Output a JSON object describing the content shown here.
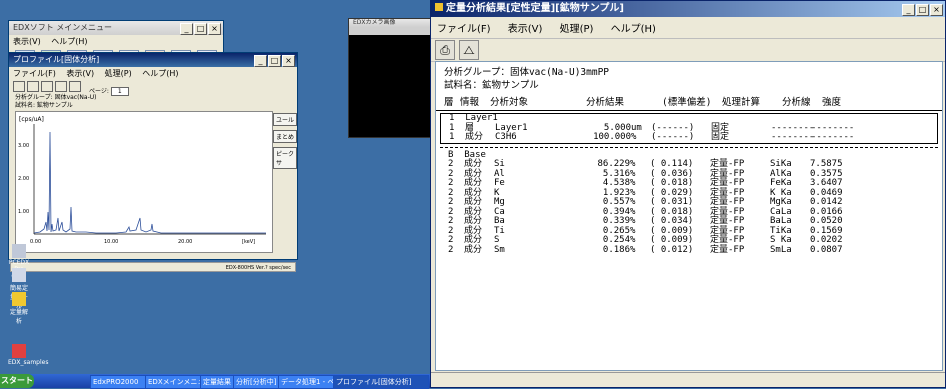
{
  "background_windows": {
    "launcher_title": "EDXソフト メインメニュー",
    "launcher_menu": [
      "表示(V)",
      "ヘルプ(H)"
    ],
    "profile_title": "プロファイル[固体分析]",
    "profile_menu": [
      "ファイル(F)",
      "表示(V)",
      "処理(P)",
      "ヘルプ(H)"
    ],
    "profile_group_label": "分析グループ: 固体vac(Na-U)",
    "profile_sample_label": "試料名: 鉱物サンプル",
    "profile_page_label": "ページ:",
    "profile_page_value": "1",
    "plot_ylabel": "[cps/uA]",
    "plot_yticks": [
      "1.00",
      "2.00",
      "3.00"
    ],
    "plot_xticks": [
      "0.00",
      "10.00",
      "20.00"
    ],
    "plot_xunit": "[keV]",
    "right_buttons": [
      "ユール",
      "まとめ",
      "ピークサ"
    ],
    "bottom_status": "EDX-800HS  Ver.? spec/sec",
    "dark_window_title": "EDXカメラ画像"
  },
  "desktop_icons": [
    {
      "label": "PCEDX Pro Conf."
    },
    {
      "label": "簡易定量ツール"
    },
    {
      "label": "定量解析"
    },
    {
      "label": "EDX_samples"
    }
  ],
  "taskbar": {
    "start_label": "スタート",
    "items": [
      "EdxPRO2000",
      "EDXメインメニュー",
      "定量結果",
      "分析[分析中]",
      "データ処理1 - ペイント",
      "プロファイル[固体分析]"
    ]
  },
  "main_window": {
    "title": "定量分析結果[定性定量][鉱物サンプル]",
    "menu": [
      "ファイル(F)",
      "表示(V)",
      "処理(P)",
      "ヘルプ(H)"
    ],
    "toolbar": [
      "print-icon",
      "spectrum-icon"
    ],
    "group_label": "分析グループ：",
    "group_value": "固体vac(Na-U)3mmPP",
    "sample_label": "試料名：",
    "sample_value": "鉱物サンプル",
    "headers": [
      "層",
      "情報",
      "分析対象",
      "分析結果",
      "(標準偏差)",
      "処理計算",
      "分析線",
      "強度"
    ],
    "layer1": {
      "title": "1  Layer1",
      "rows": [
        [
          "1",
          "層",
          "Layer1",
          "5.000",
          "um",
          "(------)",
          "固定",
          "--------",
          "--------"
        ],
        [
          "1",
          "成分",
          "C3H6",
          "100.000",
          "%",
          "(------)",
          "固定",
          "--------",
          "--------"
        ]
      ]
    },
    "base": {
      "title": "B  Base",
      "rows": [
        [
          "2",
          "成分",
          "Si",
          "86.229",
          "%",
          "( 0.114)",
          "定量-FP",
          "SiKa",
          "7.5875"
        ],
        [
          "2",
          "成分",
          "Al",
          "5.316",
          "%",
          "( 0.036)",
          "定量-FP",
          "AlKa",
          "0.3575"
        ],
        [
          "2",
          "成分",
          "Fe",
          "4.538",
          "%",
          "( 0.018)",
          "定量-FP",
          "FeKa",
          "3.6407"
        ],
        [
          "2",
          "成分",
          "K",
          "1.923",
          "%",
          "( 0.029)",
          "定量-FP",
          "K Ka",
          "0.0469"
        ],
        [
          "2",
          "成分",
          "Mg",
          "0.557",
          "%",
          "( 0.031)",
          "定量-FP",
          "MgKa",
          "0.0142"
        ],
        [
          "2",
          "成分",
          "Ca",
          "0.394",
          "%",
          "( 0.018)",
          "定量-FP",
          "CaLa",
          "0.0166"
        ],
        [
          "2",
          "成分",
          "Ba",
          "0.339",
          "%",
          "( 0.034)",
          "定量-FP",
          "BaLa",
          "0.0520"
        ],
        [
          "2",
          "成分",
          "Ti",
          "0.265",
          "%",
          "( 0.009)",
          "定量-FP",
          "TiKa",
          "0.1569"
        ],
        [
          "2",
          "成分",
          "S",
          "0.254",
          "%",
          "( 0.009)",
          "定量-FP",
          "S Ka",
          "0.0202"
        ],
        [
          "2",
          "成分",
          "Sm",
          "0.186",
          "%",
          "( 0.012)",
          "定量-FP",
          "SmLa",
          "0.0807"
        ]
      ]
    }
  },
  "colors": {
    "desktop": "#3c6ea5",
    "title_active": "#0a246a",
    "spectrum_line": "#2d4f9a"
  }
}
